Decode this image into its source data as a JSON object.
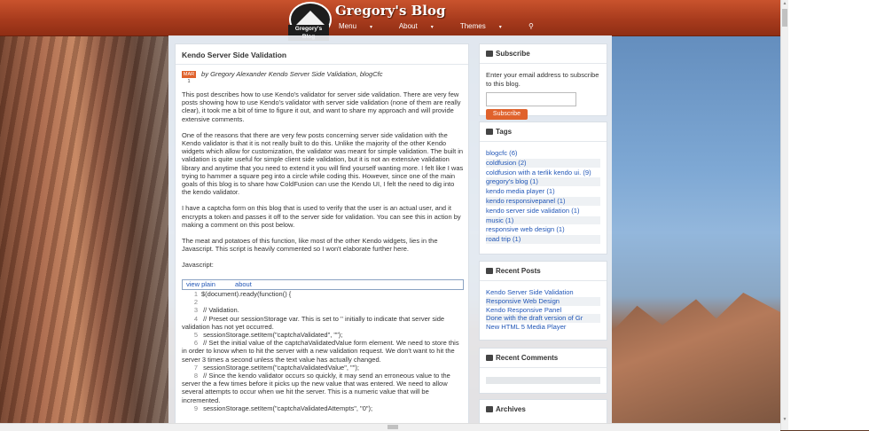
{
  "header": {
    "logo_text": "Gregory's Blog",
    "blog_title": "Gregory's Blog",
    "nav": [
      {
        "label": "Menu"
      },
      {
        "label": "About"
      },
      {
        "label": "Themes"
      }
    ]
  },
  "post": {
    "title": "Kendo Server Side Validation",
    "date_month": "MAR",
    "date_day": "1",
    "byline": "by Gregory Alexander Kendo Server Side Validation, blogCfc",
    "paragraphs": [
      "This post describes how to use Kendo's validator for server side validation. There are very few posts showing how to use Kendo's validator with server side validation (none of them are really clear), it took me a bit of time to figure it out, and want to share my approach and will provide extensive comments.",
      "One of the reasons that there are very few posts concerning server side validation with the Kendo validator is that it is not really built to do this. Unlike the majority of the other Kendo widgets which allow for customization, the validator was meant for simple validation. The built in validation is quite useful for simple client side validation, but it is not an extensive validation library and anytime that you need to extend it you will find yourself wanting more. I felt like I was trying to hammer a square peg into a circle while coding this. However, since one of the main goals of this blog is to share how ColdFusion can use the Kendo UI, I felt the need to dig into the kendo validator.",
      "I have a captcha form on this blog that is used to verify that the user is an actual user, and it encrypts a token and passes it off to the server side for validation. You can see this in action by making a comment on this post below.",
      "The meat and potatoes of this function, like most of the other Kendo widgets, lies in the Javascript. This script is heavily commented so I won't elaborate further here.",
      "Javascript:"
    ],
    "code_toolbar": [
      "view plain",
      "about"
    ],
    "code_lines": [
      {
        "num": "1",
        "text": "$(document).ready(function() {"
      },
      {
        "num": "2",
        "text": ""
      },
      {
        "num": "3",
        "text": "        // Validation."
      },
      {
        "num": "4",
        "text": "        // Preset our sessionStorage var. This is set to '' initially to indicate that server side validation has not yet occurred."
      },
      {
        "num": "5",
        "text": "        sessionStorage.setItem(\"captchaValidated\", \"\");"
      },
      {
        "num": "6",
        "text": "        // Set the initial value of the captchaValidatedValue form element. We need to store this in order to know when to hit the server with a new validation request. We don't want to hit the server 3 times a second unless the text value has actually changed."
      },
      {
        "num": "7",
        "text": "        sessionStorage.setItem(\"captchaValidatedValue\", \"\");"
      },
      {
        "num": "8",
        "text": "        // Since the kendo validator occurs so quickly, it may send an erroneous value to the server the a few times before it picks up the new value that was entered. We need to allow several attempts to occur when we hit the server. This is a numeric value that will be incremented."
      },
      {
        "num": "9",
        "text": "        sessionStorage.setItem(\"captchaValidatedAttempts\", \"0\");"
      }
    ]
  },
  "sidebar": {
    "subscribe": {
      "title": "Subscribe",
      "text": "Enter your email address to subscribe to this blog.",
      "input_placeholder": "",
      "button_label": "Subscribe"
    },
    "tags": {
      "title": "Tags",
      "items": [
        "blogcfc (6)",
        "coldfusion (2)",
        "coldfusion with a terlik kendo ui. (9)",
        "gregory's blog (1)",
        "kendo media player (1)",
        "kendo responsivepanel (1)",
        "kendo server side validation (1)",
        "music (1)",
        "responsive web design (1)",
        "road trip (1)"
      ]
    },
    "recent_posts": {
      "title": "Recent Posts",
      "items": [
        "Kendo Server Side Validation",
        "Responsive Web Design",
        "Kendo Responsive Panel",
        "Done with the draft version of Gr",
        "New HTML 5 Media Player"
      ]
    },
    "recent_comments": {
      "title": "Recent Comments"
    },
    "archives": {
      "title": "Archives"
    }
  },
  "colors": {
    "header_orange": "#a83b1d",
    "button_orange": "#e0622c",
    "link_blue": "#2257b7"
  },
  "icons": {
    "search": "search-icon",
    "subscribe": "envelope-icon",
    "tags": "tag-icon",
    "recent_posts": "list-icon",
    "recent_comments": "comments-icon",
    "archives": "archive-icon"
  }
}
